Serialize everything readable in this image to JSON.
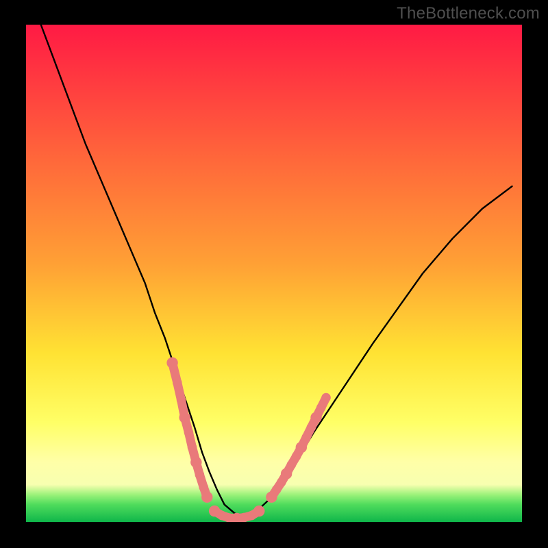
{
  "watermark": "TheBottleneck.com",
  "colors": {
    "bg_outer": "#000000",
    "grad_top": "#ff1a44",
    "grad_upper_mid": "#ffa035",
    "grad_mid": "#ffe233",
    "grad_lower_mid": "#ffff66",
    "grad_light_band": "#ffffa8",
    "grad_green_top": "#9cf27a",
    "grad_green_mid": "#4fdc5c",
    "grad_green_bot": "#0fb64a",
    "curve": "#000000",
    "marker_fill": "#e97a7a",
    "marker_stroke": "#e97a7a"
  },
  "chart_data": {
    "type": "line",
    "title": "",
    "xlabel": "",
    "ylabel": "",
    "xlim": [
      0,
      100
    ],
    "ylim": [
      0,
      100
    ],
    "curve": {
      "x": [
        3,
        6,
        9,
        12,
        15,
        18,
        21,
        24,
        26,
        28,
        30,
        32,
        34,
        35.5,
        37,
        38.5,
        40,
        42,
        44,
        46,
        49,
        52,
        55,
        58,
        62,
        66,
        70,
        75,
        80,
        86,
        92,
        98
      ],
      "y": [
        100,
        92,
        84,
        76,
        69,
        62,
        55,
        48,
        42,
        37,
        31,
        25,
        19,
        14,
        10,
        6.5,
        3.5,
        1.8,
        0.7,
        1.7,
        4.5,
        8.5,
        13,
        18,
        24,
        30,
        36,
        43,
        50,
        57,
        63,
        67.5
      ]
    },
    "series": [
      {
        "name": "segment-left",
        "x": [
          29.5,
          30.5,
          31.3,
          32.0,
          32.8,
          33.5,
          34.3,
          35.0,
          35.8,
          36.5
        ],
        "y": [
          32.0,
          28.0,
          24.5,
          21.0,
          18.0,
          15.0,
          12.0,
          9.5,
          7.0,
          5.0
        ]
      },
      {
        "name": "segment-bottom",
        "x": [
          38.0,
          39.5,
          41.0,
          42.5,
          44.0,
          45.5,
          47.0
        ],
        "y": [
          2.2,
          1.3,
          0.8,
          0.7,
          0.9,
          1.3,
          2.2
        ]
      },
      {
        "name": "segment-right",
        "x": [
          49.5,
          50.5,
          51.5,
          52.5,
          53.5,
          54.5,
          55.5,
          56.5,
          57.5,
          58.5,
          59.5,
          60.5
        ],
        "y": [
          5.0,
          6.5,
          8.0,
          9.7,
          11.5,
          13.2,
          15.0,
          17.0,
          19.0,
          21.0,
          23.0,
          25.0
        ]
      }
    ]
  }
}
